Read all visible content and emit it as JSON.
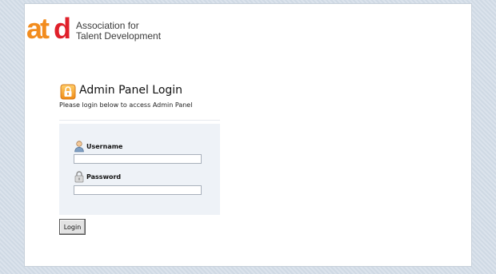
{
  "brand": {
    "logo_mark": "atd",
    "line1": "Association for",
    "line2": "Talent Development"
  },
  "login": {
    "title": "Admin Panel Login",
    "subtitle": "Please login below to access Admin Panel",
    "username_label": "Username",
    "password_label": "Password",
    "username_value": "",
    "password_value": "",
    "submit_label": "Login"
  },
  "icons": {
    "title": "lock-icon",
    "username": "user-icon",
    "password": "padlock-icon"
  },
  "colors": {
    "brand_orange": "#f28c1e",
    "brand_red": "#e0202a",
    "form_bg": "#eef2f7",
    "page_bg": "#d4dde8"
  }
}
